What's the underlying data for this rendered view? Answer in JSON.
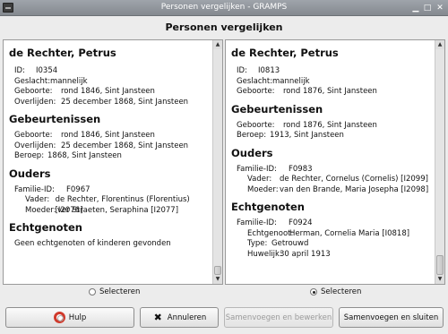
{
  "window": {
    "title": "Personen vergelijken - GRAMPS"
  },
  "header": {
    "title": "Personen vergelijken"
  },
  "left": {
    "name": "de Rechter, Petrus",
    "id_label": "ID:",
    "id_value": "I0354",
    "gender_label": "Geslacht:",
    "gender_value": "mannelijk",
    "birth_label": "Geboorte:",
    "birth_value": "rond 1846, Sint Jansteen",
    "death_label": "Overlijden:",
    "death_value": "25 december 1868, Sint Jansteen",
    "events_heading": "Gebeurtenissen",
    "ev_birth_label": "Geboorte:",
    "ev_birth_value": "rond 1846, Sint Jansteen",
    "ev_death_label": "Overlijden:",
    "ev_death_value": "25 december 1868, Sint Jansteen",
    "ev_occ_label": "Beroep:",
    "ev_occ_value": "1868, Sint Jansteen",
    "parents_heading": "Ouders",
    "family_label": "Familie-ID:",
    "family_value": "F0967",
    "father_label": "Vader:",
    "father_value": "de Rechter, Florentinus (Florentius) [I2076]",
    "mother_label": "Moeder:",
    "mother_value": "ver Straeten, Seraphina [I2077]",
    "spouses_heading": "Echtgenoten",
    "spouses_note": "Geen echtgenoten of kinderen gevonden",
    "select_label": "Selecteren",
    "selected": false
  },
  "right": {
    "name": "de Rechter, Petrus",
    "id_label": "ID:",
    "id_value": "I0813",
    "gender_label": "Geslacht:",
    "gender_value": "mannelijk",
    "birth_label": "Geboorte:",
    "birth_value": "rond 1876, Sint Jansteen",
    "events_heading": "Gebeurtenissen",
    "ev_birth_label": "Geboorte:",
    "ev_birth_value": "rond 1876, Sint Jansteen",
    "ev_occ_label": "Beroep:",
    "ev_occ_value": "1913, Sint Jansteen",
    "parents_heading": "Ouders",
    "family_label": "Familie-ID:",
    "family_value": "F0983",
    "father_label": "Vader:",
    "father_value": "de Rechter, Cornelus (Cornelis) [I2099]",
    "mother_label": "Moeder:",
    "mother_value": "van den Brande, Maria Josepha [I2098]",
    "spouses_heading": "Echtgenoten",
    "sp_family_label": "Familie-ID:",
    "sp_family_value": "F0924",
    "sp_spouse_label": "Echtgenoot:",
    "sp_spouse_value": "Herman, Cornelia Maria [I0818]",
    "sp_type_label": "Type:",
    "sp_type_value": "Getrouwd",
    "sp_marriage_label": "Huwelijk:",
    "sp_marriage_value": "30 april 1913",
    "select_label": "Selecteren",
    "selected": true
  },
  "buttons": {
    "help": "Hulp",
    "cancel": "Annuleren",
    "merge_edit": "Samenvoegen en bewerken",
    "merge_close": "Samenvoegen en sluiten"
  },
  "icons": {
    "help": "lifebuoy-icon",
    "cancel": "close-x-icon"
  },
  "colors": {
    "titlebar": "#8f949a",
    "lifebuoy": "#d03a2c"
  }
}
